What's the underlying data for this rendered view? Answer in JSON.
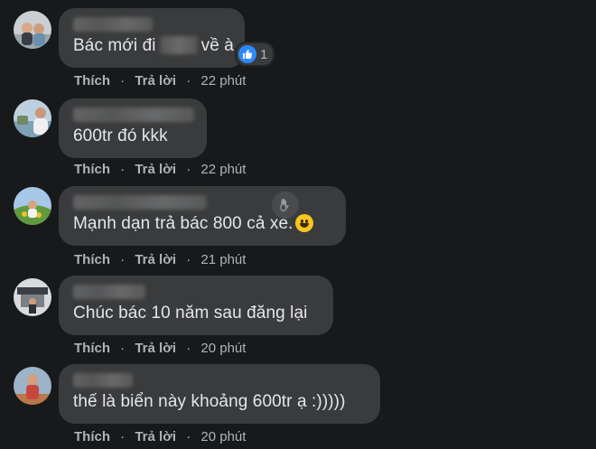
{
  "comments": [
    {
      "text_before": "Bác mới đi",
      "text_after": "về à",
      "reaction_count": "1",
      "like_label": "Thích",
      "reply_label": "Trả lời",
      "time": "22 phút"
    },
    {
      "text": "600tr đó kkk",
      "like_label": "Thích",
      "reply_label": "Trả lời",
      "time": "22 phút"
    },
    {
      "text": "Mạnh dạn trả bác 800 cả xe.",
      "like_label": "Thích",
      "reply_label": "Trả lời",
      "time": "21 phút"
    },
    {
      "text": "Chúc bác 10 năm sau đăng lại",
      "like_label": "Thích",
      "reply_label": "Trả lời",
      "time": "20 phút"
    },
    {
      "text": "thế là biển này khoảng 600tr ạ :)))))",
      "like_label": "Thích",
      "reply_label": "Trả lời",
      "time": "20 phút"
    }
  ],
  "icons": {
    "reaction": "like-thumb-icon",
    "wave": "waving-hand-icon",
    "emoji": "grinning-face-emoji"
  },
  "colors": {
    "background": "#18191a",
    "bubble": "#3a3b3c",
    "text": "#e4e6eb",
    "secondary_text": "#b0b3b8",
    "like_blue": "#2d88ff"
  }
}
